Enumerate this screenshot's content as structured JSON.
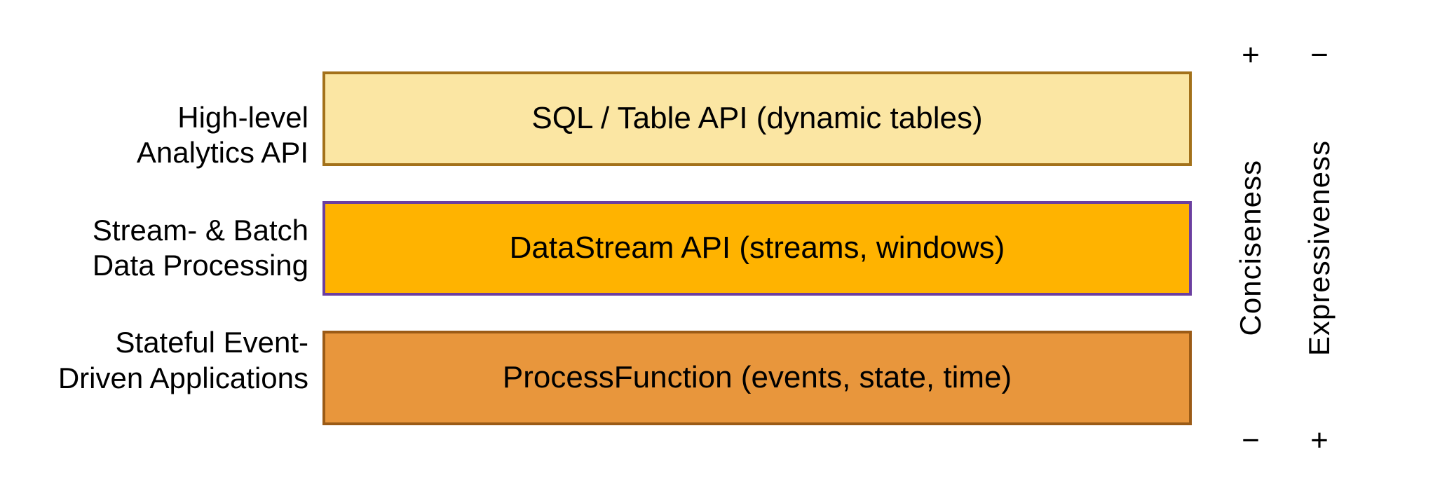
{
  "labels": [
    {
      "line1": "High-level",
      "line2": "Analytics API"
    },
    {
      "line1": "Stream- & Batch",
      "line2": "Data Processing"
    },
    {
      "line1": "Stateful Event-",
      "line2": "Driven Applications"
    }
  ],
  "layers": [
    {
      "text": "SQL / Table API (dynamic tables)"
    },
    {
      "text": "DataStream API (streams, windows)"
    },
    {
      "text": "ProcessFunction (events, state, time)"
    }
  ],
  "axes": [
    {
      "top": "+",
      "bottom": "−",
      "label": "Conciseness"
    },
    {
      "top": "−",
      "bottom": "+",
      "label": "Expressiveness"
    }
  ],
  "colors": {
    "layer1_bg": "#fbe6a3",
    "layer1_border": "#a3711a",
    "layer2_bg": "#ffb300",
    "layer2_border": "#6b3fa0",
    "layer3_bg": "#e8963c",
    "layer3_border": "#9b5b16"
  }
}
